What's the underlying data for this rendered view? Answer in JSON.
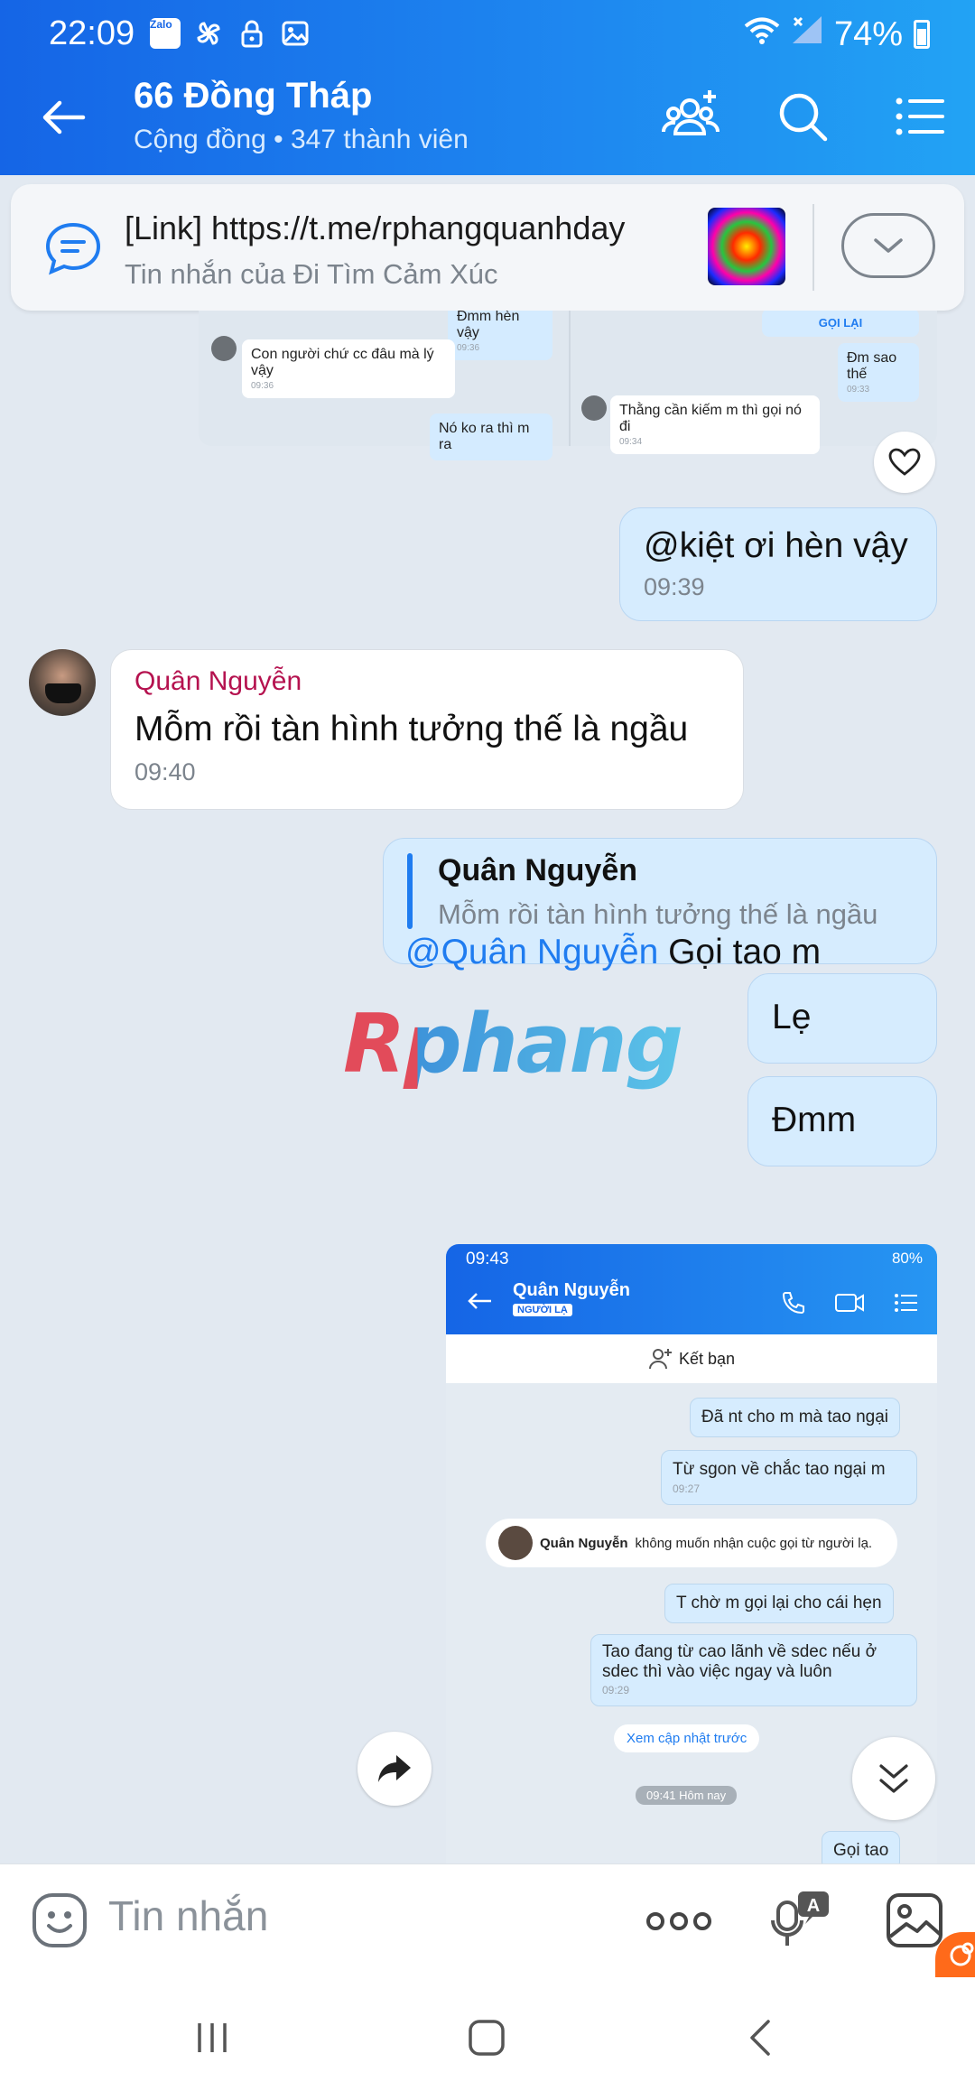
{
  "status_bar": {
    "time": "22:09",
    "battery": "74%",
    "app_badge": "Zalo"
  },
  "header": {
    "title": "66 Đồng Tháp",
    "subtitle": "Cộng đồng • 347 thành viên"
  },
  "pinned": {
    "title": "[Link] https://t.me/rphangquanhday",
    "subtitle": "Tin nhắn của Đi Tìm Cảm Xúc"
  },
  "embedded_shot_1": {
    "msg_top_left": "Đmm hèn vậy",
    "msg_top_left_time": "09:36",
    "msg_left": "Con người chứ cc đâu mà lý vậy",
    "msg_left_time": "09:36",
    "msg_left_bottom": "Nó ko ra thì m ra",
    "call_back": "GỌI LẠI",
    "msg_right": "Đm sao thế",
    "msg_right_time": "09:33",
    "msg_right_bottom": "Thằng cần kiếm m thì gọi nó đi",
    "msg_right_bottom_time": "09:34"
  },
  "messages": {
    "me1_text": "@kiệt ơi hèn vậy",
    "me1_time": "09:39",
    "them_sender": "Quân Nguyễn",
    "them_text": "Mỗm rồi tàn hình tưởng thế là ngầu",
    "them_time": "09:40",
    "quote_sender": "Quân Nguyễn",
    "quote_text": "Mỗm rồi tàn hình tưởng thế là ngầu",
    "reply_mention": "@Quân Nguyễn",
    "reply_text": " Gọi tao m",
    "me2_text": "Lẹ",
    "me3_text": "Đmm"
  },
  "watermark": "Rphang",
  "embedded_shot_2": {
    "status_time": "09:43",
    "status_battery": "80%",
    "name": "Quân Nguyễn",
    "tag": "NGƯỜI LẠ",
    "add_friend": "Kết bạn",
    "msg1": "Đã nt cho m mà tao ngại",
    "msg2": "Từ sgon về chắc tao ngại m",
    "msg2_time": "09:27",
    "call_name": "Quân Nguyễn",
    "call_text": "không muốn nhận cuộc gọi từ người lạ.",
    "msg3": "T chờ m  gọi lại cho cái hẹn",
    "msg4": "Tao đang từ cao lãnh về sdec nếu ở sdec thì vào việc ngay và luôn",
    "msg4_time": "09:29",
    "update_btn": "Xem cập nhật trước",
    "day_label": "09:41 Hôm nay",
    "msg5": "Gọi tao"
  },
  "composer": {
    "placeholder": "Tin nhắn"
  },
  "colors": {
    "header_start": "#1565e6",
    "header_end": "#22a3f4",
    "my_bubble": "#d6ecfe",
    "sender_name": "#b5124f",
    "mention": "#1f7cf0"
  }
}
